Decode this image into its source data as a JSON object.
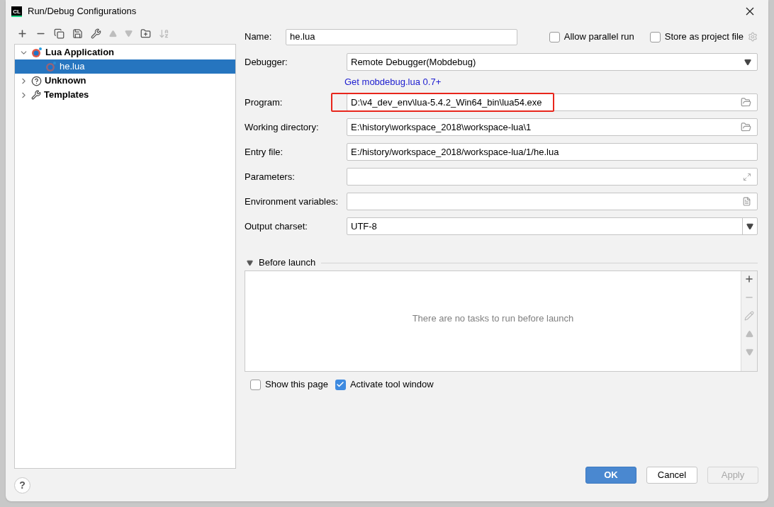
{
  "window": {
    "title": "Run/Debug Configurations",
    "app_badge": "CL"
  },
  "toolbar": [
    {
      "kind": "add",
      "disabled": false
    },
    {
      "kind": "remove",
      "disabled": false
    },
    {
      "kind": "copy",
      "disabled": false
    },
    {
      "kind": "save",
      "disabled": false
    },
    {
      "kind": "wrench",
      "disabled": false
    },
    {
      "kind": "up",
      "disabled": true
    },
    {
      "kind": "down",
      "disabled": true
    },
    {
      "kind": "folder",
      "disabled": false
    },
    {
      "kind": "sort",
      "disabled": true
    }
  ],
  "tree": [
    {
      "label": "Lua Application",
      "kind": "lua",
      "expanded": true,
      "selected": false,
      "children": [
        {
          "label": "he.lua",
          "kind": "lua",
          "selected": true
        }
      ]
    },
    {
      "label": "Unknown",
      "kind": "unknown",
      "expanded": false,
      "selected": false
    },
    {
      "label": "Templates",
      "kind": "wrench",
      "expanded": false,
      "selected": false
    }
  ],
  "name_row": {
    "label": "Name:",
    "value": "he.lua",
    "options": [
      {
        "label": "Allow parallel run",
        "checked": false
      },
      {
        "label": "Store as project file",
        "checked": false
      }
    ]
  },
  "fields": [
    {
      "kind": "select",
      "label": "Debugger:",
      "value": "Remote Debugger(Mobdebug)"
    },
    {
      "kind": "link",
      "label": "Get mobdebug.lua 0.7+"
    },
    {
      "kind": "browse",
      "label": "Program:",
      "value": "D:\\v4_dev_env\\lua-5.4.2_Win64_bin\\lua54.exe",
      "highlighted": true
    },
    {
      "kind": "browse",
      "label": "Working directory:",
      "value": "E:\\history\\workspace_2018\\workspace-lua\\1"
    },
    {
      "kind": "text",
      "label": "Entry file:",
      "value": "E:/history/workspace_2018/workspace-lua/1/he.lua"
    },
    {
      "kind": "expand",
      "label": "Parameters:"
    },
    {
      "kind": "list",
      "label": "Environment variables:"
    },
    {
      "kind": "combo",
      "label": "Output charset:",
      "value": "UTF-8"
    }
  ],
  "help": {
    "label": "?"
  },
  "before_launch": {
    "title": "Before launch",
    "expanded": true,
    "empty_text": "There are no tasks to run before launch",
    "tools": [
      {
        "kind": "add",
        "disabled": false
      },
      {
        "kind": "remove",
        "disabled": true
      },
      {
        "kind": "edit",
        "disabled": true
      },
      {
        "kind": "up",
        "disabled": true
      },
      {
        "kind": "down",
        "disabled": true
      }
    ]
  },
  "launch_options": [
    {
      "label": "Show this page",
      "checked": false
    },
    {
      "label": "Activate tool window",
      "checked": true
    }
  ],
  "buttons": [
    {
      "label": "OK",
      "kind": "default",
      "disabled": false
    },
    {
      "label": "Cancel",
      "kind": "normal",
      "disabled": false
    },
    {
      "label": "Apply",
      "kind": "normal",
      "disabled": true
    }
  ]
}
